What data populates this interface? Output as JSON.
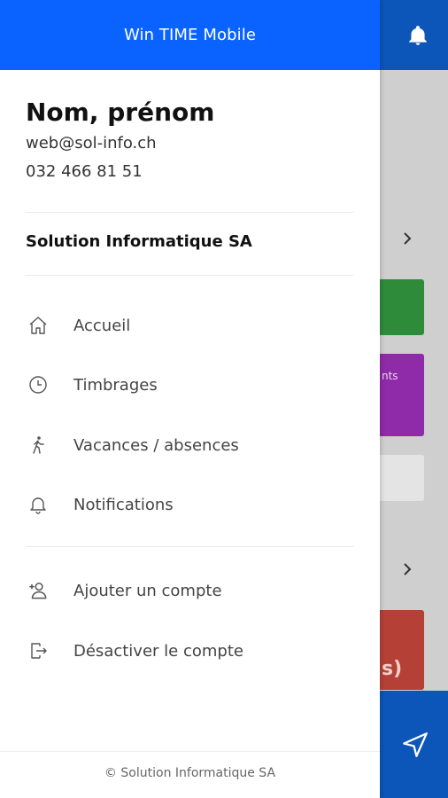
{
  "app": {
    "title": "Win TIME Mobile"
  },
  "profile": {
    "name": "Nom, prénom",
    "email": "web@sol-info.ch",
    "phone": "032 466 81 51"
  },
  "company": {
    "name": "Solution Informatique SA"
  },
  "menu": {
    "main": [
      {
        "label": "Accueil",
        "icon": "home-icon"
      },
      {
        "label": "Timbrages",
        "icon": "clock-icon"
      },
      {
        "label": "Vacances / absences",
        "icon": "walking-person-icon"
      },
      {
        "label": "Notifications",
        "icon": "bell-icon"
      }
    ],
    "account": [
      {
        "label": "Ajouter un compte",
        "icon": "add-user-icon"
      },
      {
        "label": "Désactiver le compte",
        "icon": "logout-icon"
      }
    ]
  },
  "footer": {
    "copyright": "© Solution Informatique SA"
  },
  "background": {
    "card_text_1": "nts",
    "card_text_2": "s)"
  },
  "colors": {
    "header_blue": "#0a63ff",
    "app_bar_blue": "#0b56b8",
    "card_green": "#2e8b3a",
    "card_purple": "#8f2aa8",
    "card_red": "#b54036"
  }
}
